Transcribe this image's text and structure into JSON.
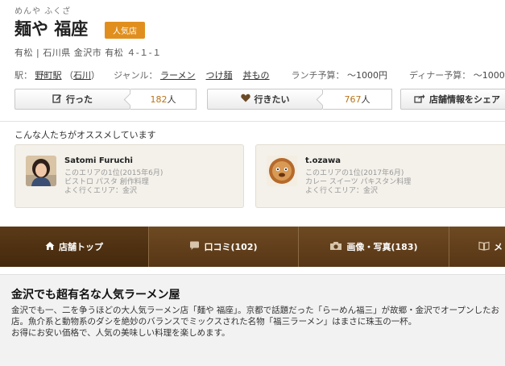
{
  "restaurant": {
    "ruby": "めんや ふくざ",
    "name": "麺や 福座",
    "badge": "人気店",
    "address": "有松 | 石川県 金沢市 有松 ４-１-１"
  },
  "info": {
    "station_label": "駅：",
    "station": "野町駅",
    "station_paren_open": "（",
    "pref": "石川",
    "station_paren_close": "）",
    "genre_label": "ジャンル：",
    "genres": [
      "ラーメン",
      "つけ麺",
      "丼もの"
    ],
    "lunch_label": "ランチ予算：",
    "lunch": "～1000円",
    "dinner_label": "ディナー予算：",
    "dinner": "～1000円"
  },
  "actions": {
    "went_label": "行った",
    "went_count": "182",
    "want_label": "行きたい",
    "want_count": "767",
    "unit": "人",
    "share_label": "店舗情報をシェア"
  },
  "recommend": {
    "title": "こんな人たちがオススメしています",
    "users": [
      {
        "name": "Satomi Furuchi",
        "rank": "このエリアの1位(2015年6月)",
        "tags": "ビストロ パスタ 創作料理",
        "area": "よく行くエリア：金沢"
      },
      {
        "name": "t.ozawa",
        "rank": "このエリアの1位(2017年6月)",
        "tags": "カレー スイーツ パキスタン料理",
        "area": "よく行くエリア：金沢"
      }
    ]
  },
  "nav": {
    "tabs": [
      {
        "label": "店舗トップ",
        "icon": "home-icon"
      },
      {
        "label": "口コミ(102)",
        "icon": "speech-bubble-icon"
      },
      {
        "label": "画像・写真(183)",
        "icon": "camera-icon"
      },
      {
        "label": "メ",
        "icon": "book-icon"
      }
    ]
  },
  "description": {
    "heading": "金沢でも超有名な人気ラーメン屋",
    "line1": "金沢でも一、二を争うほどの大人気ラーメン店「麺や 福座」。京都で話題だった「らーめん福三」が故郷・金沢でオープンしたお店。魚介系と動物系のダシを絶妙のバランスでミックスされた名物「福三ラーメン」はまさに珠玉の一杯。",
    "line2": "お得にお安い価格で、人気の美味しい料理を楽しめます。"
  },
  "colors": {
    "badge": "#e08f1e",
    "nav_bg": "#5f3e1a",
    "count_text": "#b8741a"
  }
}
